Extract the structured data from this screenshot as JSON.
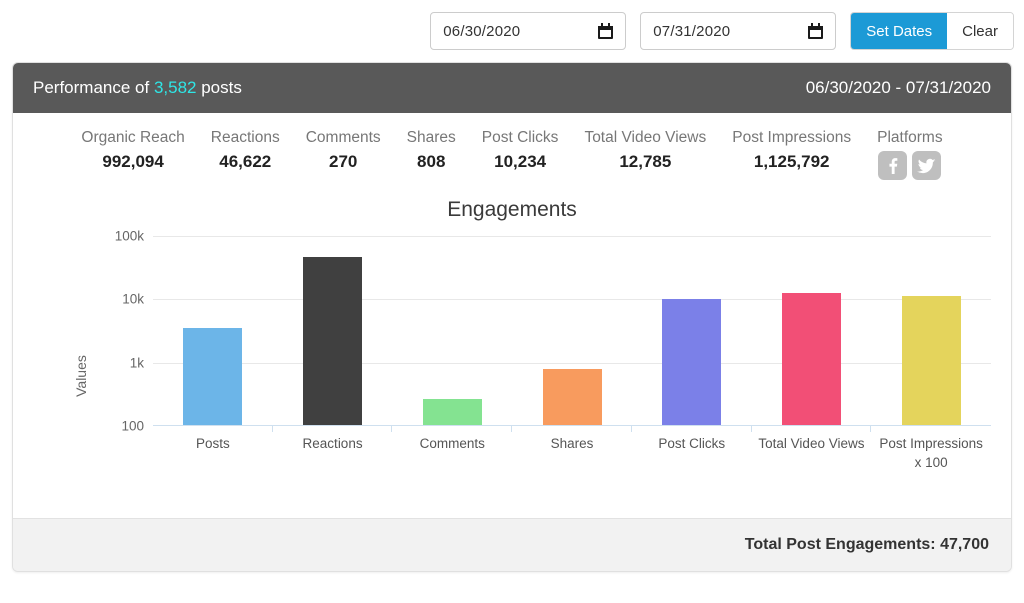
{
  "toolbar": {
    "start_date": "06/30/2020",
    "end_date": "07/31/2020",
    "set_dates_label": "Set Dates",
    "clear_label": "Clear",
    "calendar_icon": "calendar-icon"
  },
  "header": {
    "prefix": "Performance of ",
    "post_count": "3,582",
    "suffix": " posts",
    "date_range": "06/30/2020 - 07/31/2020",
    "accent_color": "#2EE6E6",
    "background_color": "#595959"
  },
  "stats": [
    {
      "label": "Organic Reach",
      "value": "992,094"
    },
    {
      "label": "Reactions",
      "value": "46,622"
    },
    {
      "label": "Comments",
      "value": "270"
    },
    {
      "label": "Shares",
      "value": "808"
    },
    {
      "label": "Post Clicks",
      "value": "10,234"
    },
    {
      "label": "Total Video Views",
      "value": "12,785"
    },
    {
      "label": "Post Impressions",
      "value": "1,125,792"
    }
  ],
  "platforms": {
    "label": "Platforms",
    "icons": [
      "facebook-icon",
      "twitter-icon"
    ],
    "icon_color": "#BFBFBF"
  },
  "footer": {
    "total_label": "Total Post Engagements: 47,700"
  },
  "chart_data": {
    "type": "bar",
    "title": "Engagements",
    "xlabel": "",
    "ylabel": "Values",
    "yscale": "log",
    "ylim": [
      100,
      100000
    ],
    "yticks": [
      100,
      1000,
      10000,
      100000
    ],
    "ytick_labels": [
      "100",
      "1k",
      "10k",
      "100k"
    ],
    "grid": true,
    "legend": "none",
    "categories": [
      "Posts",
      "Reactions",
      "Comments",
      "Shares",
      "Post Clicks",
      "Total Video Views",
      "Post Impressions x 100"
    ],
    "values": [
      3582,
      46622,
      270,
      808,
      10234,
      12785,
      11258
    ],
    "colors": [
      "#6CB5E8",
      "#404040",
      "#84E391",
      "#F89B5E",
      "#7B80E8",
      "#F24F76",
      "#E4D45C"
    ]
  }
}
